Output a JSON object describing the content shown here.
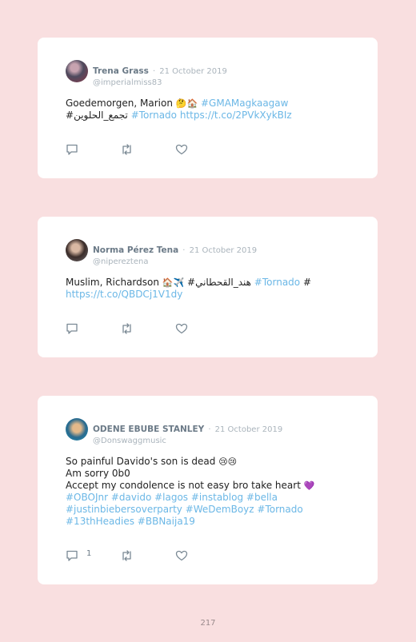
{
  "tweets": [
    {
      "name": "Trena Grass",
      "separator": "·",
      "date": "21 October 2019",
      "handle": "@imperialmiss83",
      "line1_plain": "Goedemorgen, Marion ",
      "line1_emoji": "🤔🏠",
      "line1_hash": "#GMAMagkaagaw",
      "line2_plain": "#تجمع_الحلوين ",
      "line2_hash": "#Tornado ",
      "line2_link": "https://t.co/2PVkXykBIz",
      "reply_count": ""
    },
    {
      "name": "Norma Pérez Tena",
      "separator": "·",
      "date": "21 October 2019",
      "handle": "@nipereztena",
      "line1_plain": "Muslim, Richardson ",
      "line1_emoji": "🏠✈️",
      "line1_mid": " #هند_القحطاني ",
      "line1_hash": "#Tornado",
      "line1_end": " #",
      "line2_link": "https://t.co/QBDCj1V1dy",
      "reply_count": ""
    },
    {
      "name": "ODENE EBUBE STANLEY",
      "separator": "·",
      "date": "21 October 2019",
      "handle": "@Donswaggmusic",
      "line1_plain": "So painful Davido's son is dead ",
      "line1_emoji": "😢😢",
      "line2_plain": "Am sorry 0b0",
      "line3_plain": "Accept my condolence is not easy bro take heart ",
      "line3_emoji": "💜",
      "line4_hash": "#OBOJnr #davido #lagos #instablog #bella",
      "line5_hash": "#justinbiebersoverparty #WeDemBoyz #Tornado",
      "line6_hash": "#13thHeadies #BBNaija19",
      "reply_count": "1"
    }
  ],
  "page_number": "217",
  "icons": {
    "reply": "reply-icon",
    "retweet": "retweet-icon",
    "like": "heart-icon"
  },
  "colors": {
    "background": "#f9dfe0",
    "card": "#ffffff",
    "hashtag": "#6bb7e6",
    "muted": "#aab4bc",
    "name": "#6b7a87"
  }
}
